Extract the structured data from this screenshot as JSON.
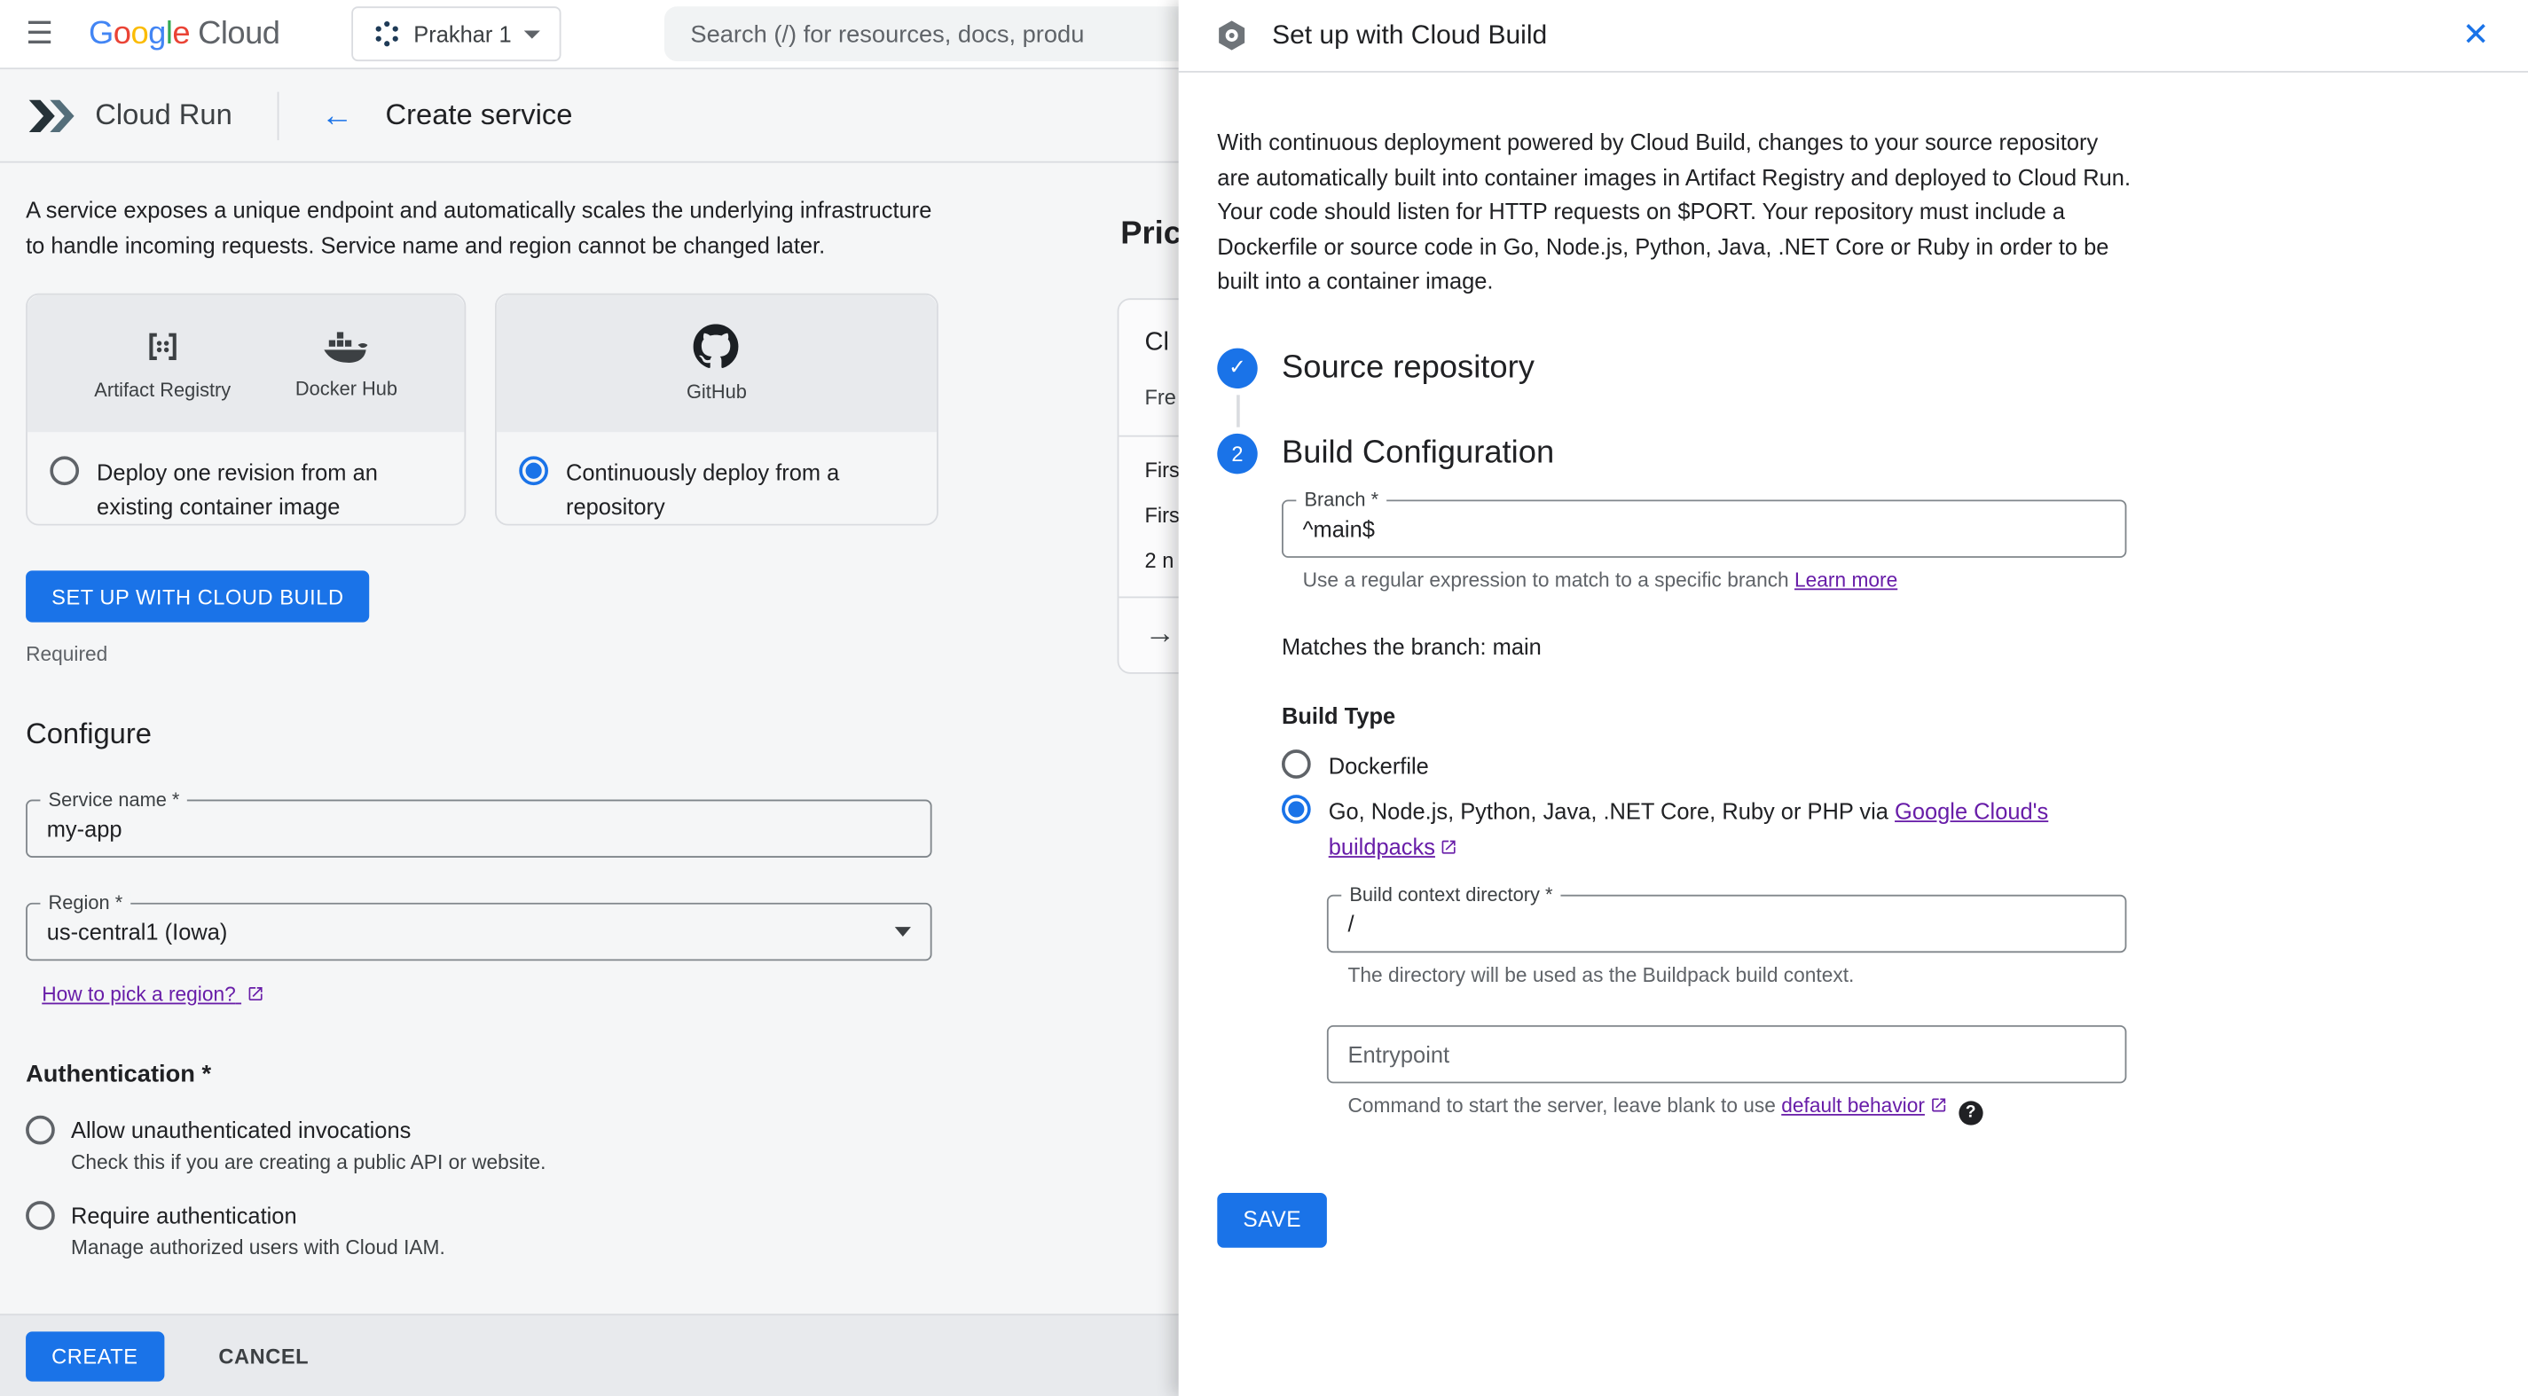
{
  "icons": {
    "hamburger": "☰",
    "back": "←",
    "check": "✓",
    "close": "✕",
    "arrow_forward": "→",
    "question": "?"
  },
  "topbar": {
    "logo_letters": [
      {
        "ch": "G",
        "color": "#4285F4"
      },
      {
        "ch": "o",
        "color": "#EA4335"
      },
      {
        "ch": "o",
        "color": "#FBBC05"
      },
      {
        "ch": "g",
        "color": "#4285F4"
      },
      {
        "ch": "l",
        "color": "#34A853"
      },
      {
        "ch": "e",
        "color": "#EA4335"
      }
    ],
    "logo_cloud": "Cloud",
    "project_name": "Prakhar 1",
    "search_placeholder": "Search (/) for resources, docs, produ"
  },
  "subheader": {
    "product": "Cloud Run",
    "page_title": "Create service"
  },
  "left": {
    "intro": "A service exposes a unique endpoint and automatically scales the underlying infrastructure to handle incoming requests. Service name and region cannot be changed later.",
    "card_registry": {
      "icon1_label": "Artifact Registry",
      "icon2_label": "Docker Hub",
      "radio_label": "Deploy one revision from an existing container image"
    },
    "card_repo": {
      "icon_label": "GitHub",
      "radio_label": "Continuously deploy from a repository"
    },
    "setup_button": "SET UP WITH CLOUD BUILD",
    "required": "Required",
    "configure_heading": "Configure",
    "service_name": {
      "label": "Service name *",
      "value": "my-app"
    },
    "region": {
      "label": "Region *",
      "value": "us-central1 (Iowa)",
      "link": "How to pick a region?"
    },
    "auth": {
      "heading": "Authentication *",
      "option1": {
        "label": "Allow unauthenticated invocations",
        "desc": "Check this if you are creating a public API or website."
      },
      "option2": {
        "label": "Require authentication",
        "desc": "Manage authorized users with Cloud IAM."
      }
    },
    "footer": {
      "create": "CREATE",
      "cancel": "CANCEL"
    }
  },
  "pricing": {
    "heading": "Pric",
    "line1": "Cl",
    "line2": "Fre",
    "line3": "Firs",
    "line4": "Firs",
    "line5": "2 n"
  },
  "panel": {
    "title": "Set up with Cloud Build",
    "intro1": "With continuous deployment powered by Cloud Build, changes to your source repository are automatically built into container images in Artifact Registry and deployed to Cloud Run.",
    "intro2": "Your code should listen for HTTP requests on $PORT. Your repository must include a Dockerfile or source code in Go, Node.js, Python, Java, .NET Core or Ruby in order to be built into a container image.",
    "step1": {
      "title": "Source repository"
    },
    "step2": {
      "number": "2",
      "title": "Build Configuration"
    },
    "branch": {
      "label": "Branch *",
      "value": "^main$",
      "helper": "Use a regular expression to match to a specific branch ",
      "helper_link": "Learn more"
    },
    "matches": "Matches the branch: main",
    "build_type_heading": "Build Type",
    "option_dockerfile": "Dockerfile",
    "option_buildpacks_prefix": "Go, Node.js, Python, Java, .NET Core, Ruby or PHP via ",
    "option_buildpacks_link": "Google Cloud's buildpacks",
    "context": {
      "label": "Build context directory *",
      "value": "/",
      "helper": "The directory will be used as the Buildpack build context."
    },
    "entrypoint": {
      "placeholder": "Entrypoint",
      "helper_prefix": "Command to start the server, leave blank to use ",
      "helper_link": "default behavior"
    },
    "save": "SAVE"
  },
  "colors": {
    "primary_blue": "#1a73e8",
    "link_purple": "#681da8"
  }
}
